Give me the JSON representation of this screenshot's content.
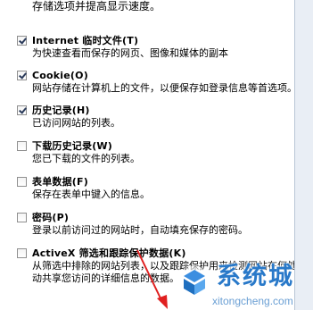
{
  "top_desc": "存储选项并提高显示速度。",
  "items": [
    {
      "label": "Internet 临时文件(T)",
      "desc": "为快速查看而保存的网页、图像和媒体的副本",
      "checked": true
    },
    {
      "label": "Cookie(O)",
      "desc": "网站存储在计算机上的文件，以便保存如登录信息等首选项。",
      "checked": true
    },
    {
      "label": "历史记录(H)",
      "desc": "已访问网站的列表。",
      "checked": true
    },
    {
      "label": "下载历史记录(W)",
      "desc": "您已下载的文件的列表。",
      "checked": false
    },
    {
      "label": "表单数据(F)",
      "desc": "保存在表单中键入的信息。",
      "checked": false
    },
    {
      "label": "密码(P)",
      "desc": "登录以前访问过的网站时，自动填充保存的密码。",
      "checked": false
    },
    {
      "label": "ActiveX 筛选和跟踪保护数据(K)",
      "desc": "从筛选中排除的网站列表，以及跟踪保护用来检测网站在何处自",
      "desc2": "动共享您访问的详细信息的数据。",
      "checked": false
    }
  ],
  "watermark": {
    "brand": "系统城",
    "url": "xitongcheng.com"
  },
  "colors": {
    "brand": "#2979c9",
    "arrow": "#e02020"
  }
}
